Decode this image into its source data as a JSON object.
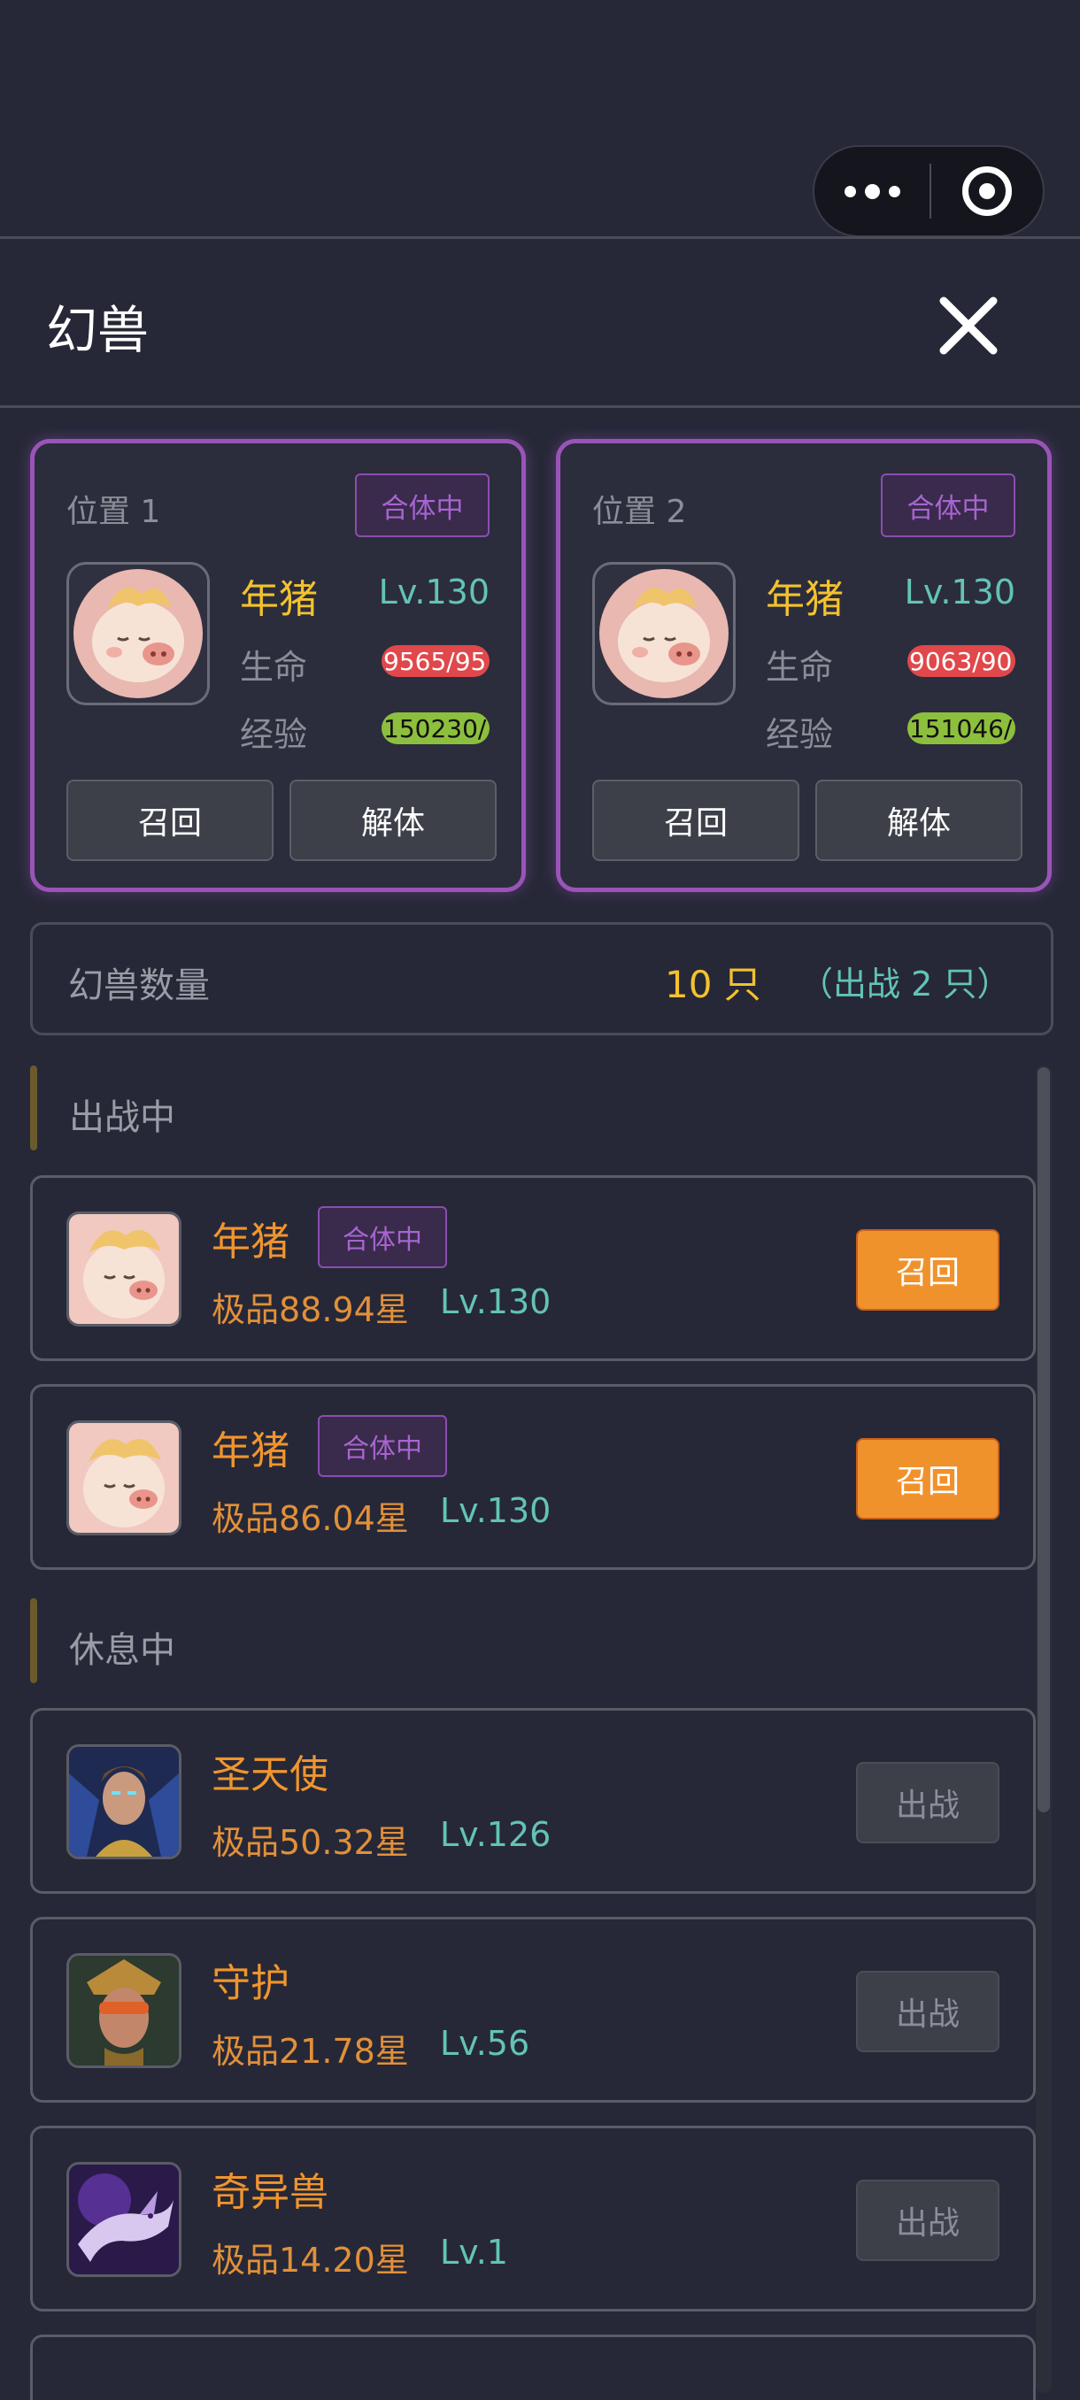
{
  "header": {
    "title": "幻兽"
  },
  "positions": [
    {
      "label": "位置 1",
      "badge": "合体中",
      "name": "年猪",
      "level": "Lv.130",
      "hp_label": "生命",
      "hp_value": "9565/95",
      "xp_label": "经验",
      "xp_value": "150230/",
      "recall_label": "召回",
      "unmerge_label": "解体"
    },
    {
      "label": "位置 2",
      "badge": "合体中",
      "name": "年猪",
      "level": "Lv.130",
      "hp_label": "生命",
      "hp_value": "9063/90",
      "xp_label": "经验",
      "xp_value": "151046/",
      "recall_label": "召回",
      "unmerge_label": "解体"
    }
  ],
  "count": {
    "label": "幻兽数量",
    "value": "10 只",
    "sub": "（出战 2 只）"
  },
  "sections": {
    "active": "出战中",
    "resting": "休息中"
  },
  "active_pets": [
    {
      "name": "年猪",
      "badge": "合体中",
      "grade": "极品88.94星",
      "level": "Lv.130",
      "action": "召回",
      "avatar_icon": "pig-avatar-icon"
    },
    {
      "name": "年猪",
      "badge": "合体中",
      "grade": "极品86.04星",
      "level": "Lv.130",
      "action": "召回",
      "avatar_icon": "pig-avatar-icon"
    }
  ],
  "resting_pets": [
    {
      "name": "圣天使",
      "grade": "极品50.32星",
      "level": "Lv.126",
      "action": "出战",
      "avatar_icon": "angel-avatar-icon"
    },
    {
      "name": "守护",
      "grade": "极品21.78星",
      "level": "Lv.56",
      "action": "出战",
      "avatar_icon": "guardian-avatar-icon"
    },
    {
      "name": "奇异兽",
      "grade": "极品14.20星",
      "level": "Lv.1",
      "action": "出战",
      "avatar_icon": "dragon-avatar-icon"
    }
  ],
  "colors": {
    "accent_gold": "#f3c22e",
    "accent_orange": "#f0922c",
    "accent_teal": "#63c3b6",
    "badge_purple": "#a765d0",
    "card_border_purple": "#9a54b8",
    "background": "#262837"
  }
}
